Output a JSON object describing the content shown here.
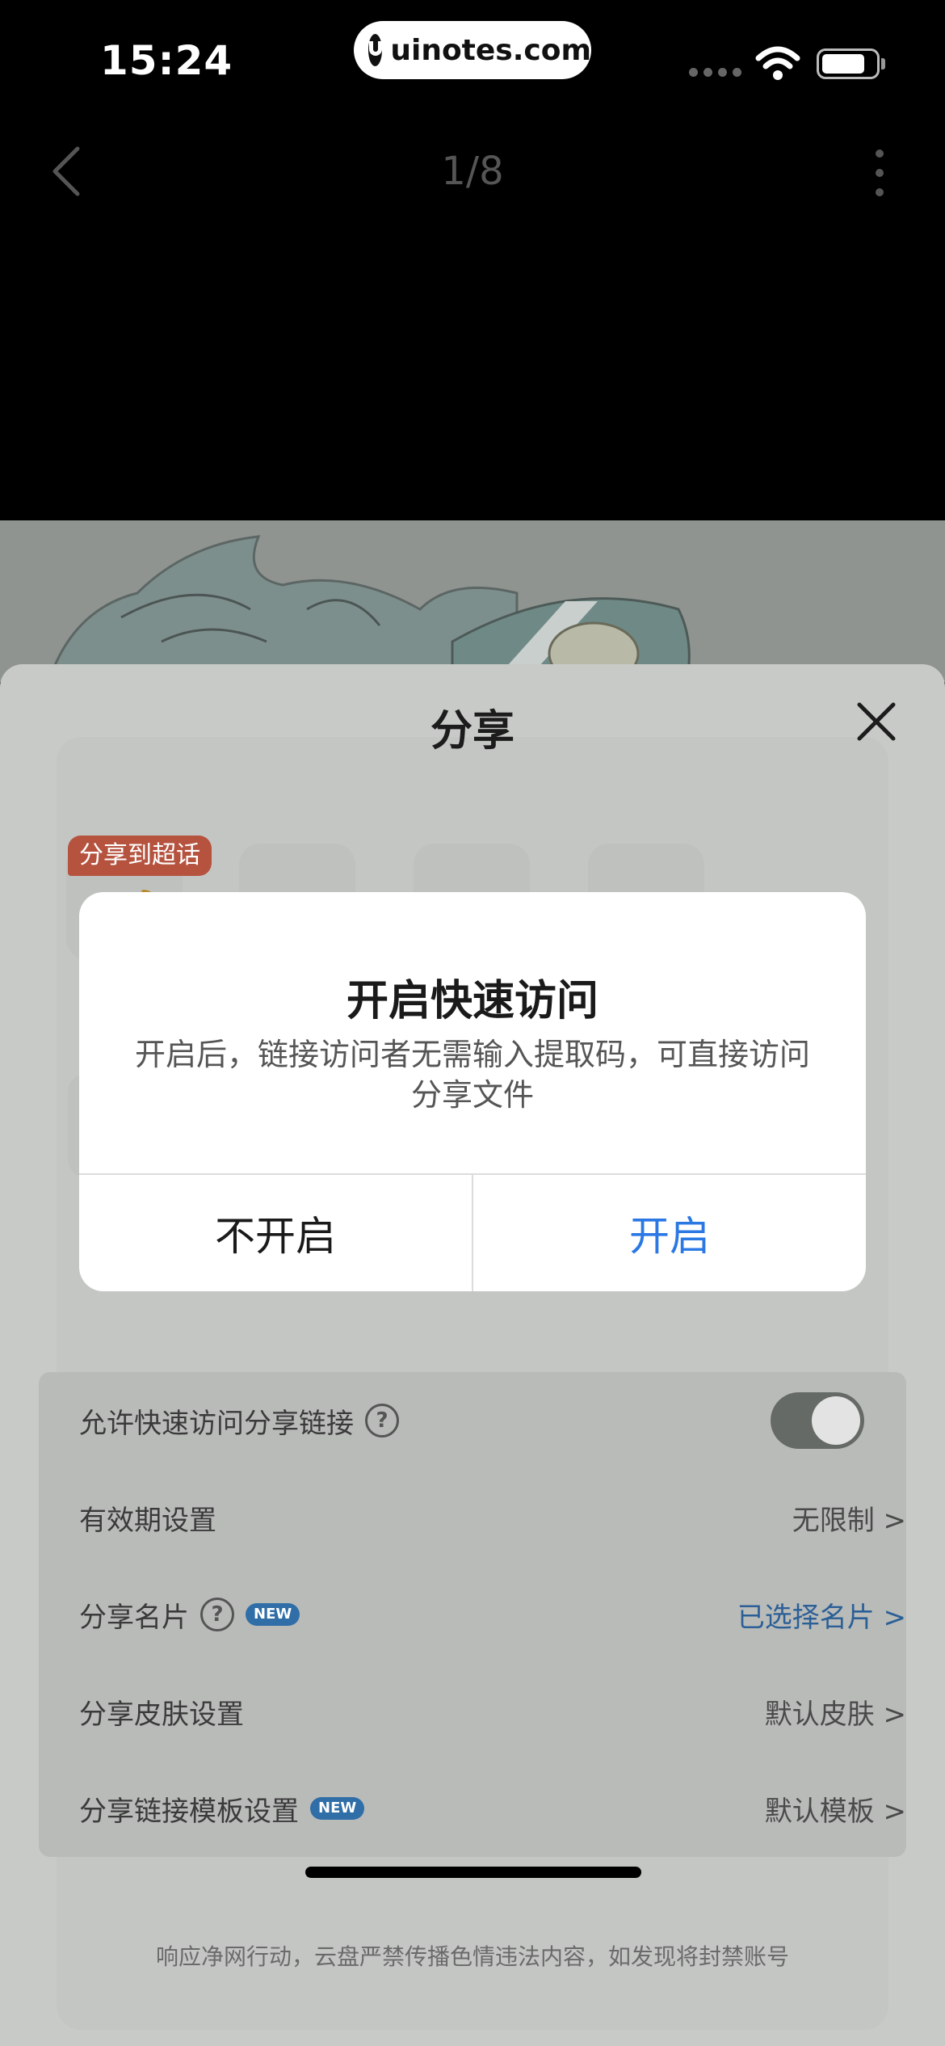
{
  "status_bar": {
    "time": "15:24",
    "site": "uinotes.com",
    "battery_level": 0.82
  },
  "viewer": {
    "page_counter": "1/8"
  },
  "share_sheet": {
    "title": "分享",
    "promo_badge": "分享到超话",
    "settings": [
      {
        "label": "允许快速访问分享链接",
        "type": "toggle",
        "checked": true
      },
      {
        "label": "有效期设置",
        "value": "无限制 >"
      },
      {
        "label": "分享名片",
        "new_badge": "NEW",
        "value": "已选择名片 >"
      },
      {
        "label": "分享皮肤设置",
        "value": "默认皮肤 >"
      },
      {
        "label": "分享链接模板设置",
        "new_badge": "NEW",
        "value": "默认模板 >"
      }
    ],
    "footer_note": "响应净网行动，云盘严禁传播色情违法内容，如发现将封禁账号"
  },
  "dialog": {
    "title": "开启快速访问",
    "message": "开启后，链接访问者无需输入提取码，可直接访问分享文件",
    "cancel_label": "不开启",
    "confirm_label": "开启"
  },
  "colors": {
    "confirm_blue": "#2b78e4",
    "link_blue": "#2b5f96",
    "promo_red": "#b5533f",
    "new_badge_blue": "#2f6ea7"
  }
}
